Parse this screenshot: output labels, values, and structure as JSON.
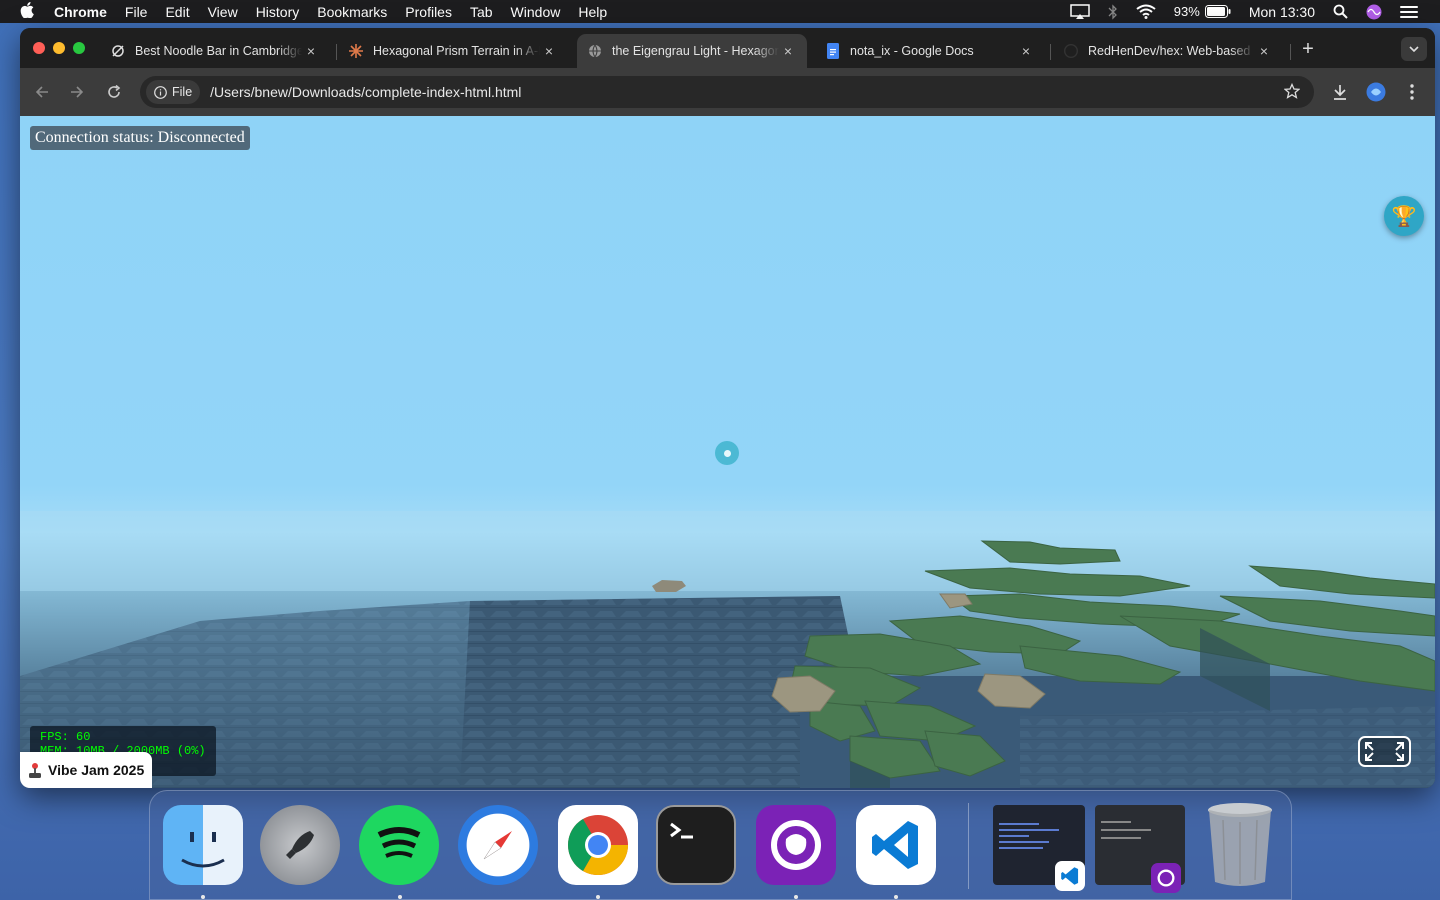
{
  "menubar": {
    "app_name": "Chrome",
    "menus": [
      "File",
      "Edit",
      "View",
      "History",
      "Bookmarks",
      "Profiles",
      "Tab",
      "Window",
      "Help"
    ],
    "battery": "93%",
    "clock": "Mon 13:30"
  },
  "browser": {
    "tabs": [
      {
        "title": "Best Noodle Bar in Cambridge",
        "favicon": "noodle-icon",
        "active": false
      },
      {
        "title": "Hexagonal Prism Terrain in A-Frame",
        "favicon": "spark-icon",
        "active": false
      },
      {
        "title": "the Eigengrau Light - Hexagon",
        "favicon": "globe-icon",
        "active": true
      },
      {
        "title": "nota_ix - Google Docs",
        "favicon": "docs-icon",
        "active": false
      },
      {
        "title": "RedHenDev/hex: Web-based",
        "favicon": "github-icon",
        "active": false
      }
    ],
    "close_glyph": "×",
    "newtab_glyph": "+",
    "omnibox": {
      "chip_label": "File",
      "url": "/Users/bnew/Downloads/complete-index-html.html"
    }
  },
  "game": {
    "connection_status": "Connection status: Disconnected",
    "fps": "FPS: 60",
    "mem": "MEM: 10MB / 2000MB (0%)",
    "vibejam_label": "Vibe Jam 2025",
    "trophy_glyph": "🏆"
  },
  "dock": {
    "apps": [
      "Finder",
      "Launchpad",
      "Spotify",
      "Safari",
      "Chrome",
      "Terminal",
      "GitHub Desktop",
      "Visual Studio Code",
      "Trash"
    ]
  },
  "colors": {
    "sky": "#8fd3f7",
    "water": "#3d5e78",
    "hex_green": "#4a7a52",
    "accent_teal": "#2fa6c6"
  }
}
